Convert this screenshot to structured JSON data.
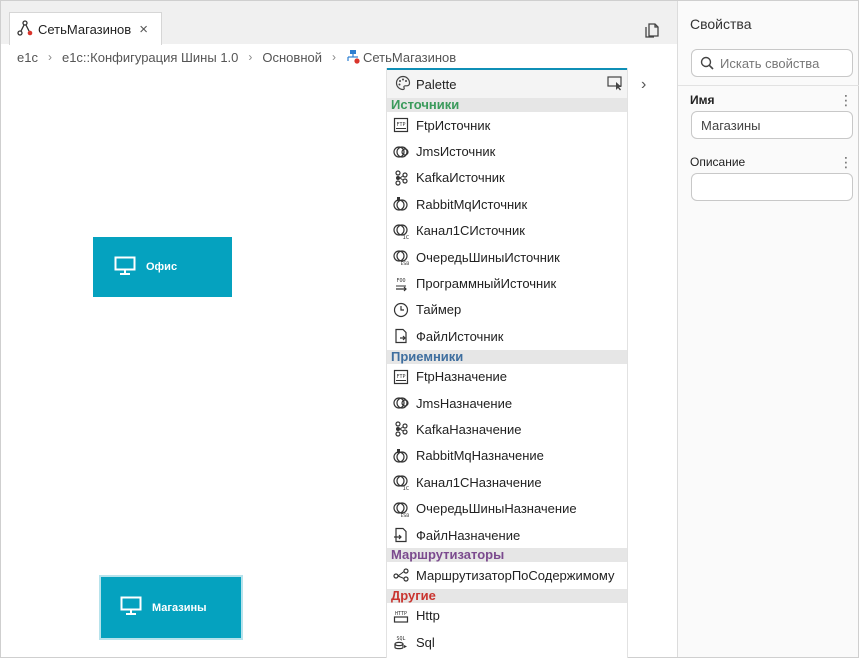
{
  "tab": {
    "label": "СетьМагазинов",
    "close": "×"
  },
  "breadcrumb": {
    "items": [
      "e1c",
      "e1c::Конфигурация Шины 1.0",
      "Основной"
    ],
    "current": "СетьМагазинов",
    "separator": "›"
  },
  "canvas": {
    "nodes": [
      {
        "label": "Офис",
        "icon": "monitor-icon"
      },
      {
        "label": "Магазины",
        "icon": "monitor-icon"
      }
    ]
  },
  "palette": {
    "title": "Palette",
    "expand_chevron": "›",
    "groups": [
      {
        "title": "Источники",
        "color": "#3a9a5b",
        "items": [
          {
            "label": "FtpИсточник",
            "icon": "ftp-icon"
          },
          {
            "label": "JmsИсточник",
            "icon": "jms-icon"
          },
          {
            "label": "KafkaИсточник",
            "icon": "kafka-icon"
          },
          {
            "label": "RabbitMqИсточник",
            "icon": "rabbitmq-icon"
          },
          {
            "label": "Канал1СИсточник",
            "icon": "channel-1c-icon"
          },
          {
            "label": "ОчередьШиныИсточник",
            "icon": "esb-queue-icon"
          },
          {
            "label": "ПрограммныйИсточник",
            "icon": "program-source-icon"
          },
          {
            "label": "Таймер",
            "icon": "timer-icon"
          },
          {
            "label": "ФайлИсточник",
            "icon": "file-source-icon"
          }
        ]
      },
      {
        "title": "Приемники",
        "color": "#3e6e9f",
        "items": [
          {
            "label": "FtpНазначение",
            "icon": "ftp-icon"
          },
          {
            "label": "JmsНазначение",
            "icon": "jms-icon"
          },
          {
            "label": "KafkaНазначение",
            "icon": "kafka-icon"
          },
          {
            "label": "RabbitMqНазначение",
            "icon": "rabbitmq-icon"
          },
          {
            "label": "Канал1СНазначение",
            "icon": "channel-1c-icon"
          },
          {
            "label": "ОчередьШиныНазначение",
            "icon": "esb-queue-icon"
          },
          {
            "label": "ФайлНазначение",
            "icon": "file-target-icon"
          }
        ]
      },
      {
        "title": "Маршрутизаторы",
        "color": "#7b4a8e",
        "items": [
          {
            "label": "МаршрутизаторПоСодержимому",
            "icon": "content-router-icon"
          }
        ]
      },
      {
        "title": "Другие",
        "color": "#c9342f",
        "items": [
          {
            "label": "Http",
            "icon": "http-icon"
          },
          {
            "label": "Sql",
            "icon": "sql-icon"
          }
        ]
      }
    ]
  },
  "properties": {
    "title": "Свойства",
    "search_placeholder": "Искать свойства",
    "fields": [
      {
        "label": "Имя",
        "value": "Магазины",
        "bold": true
      },
      {
        "label": "Описание",
        "value": "",
        "bold": false
      }
    ],
    "menu_glyph": "⋮"
  },
  "colors": {
    "accent": "#0f8fb6",
    "node_fill": "#05a2bf"
  }
}
